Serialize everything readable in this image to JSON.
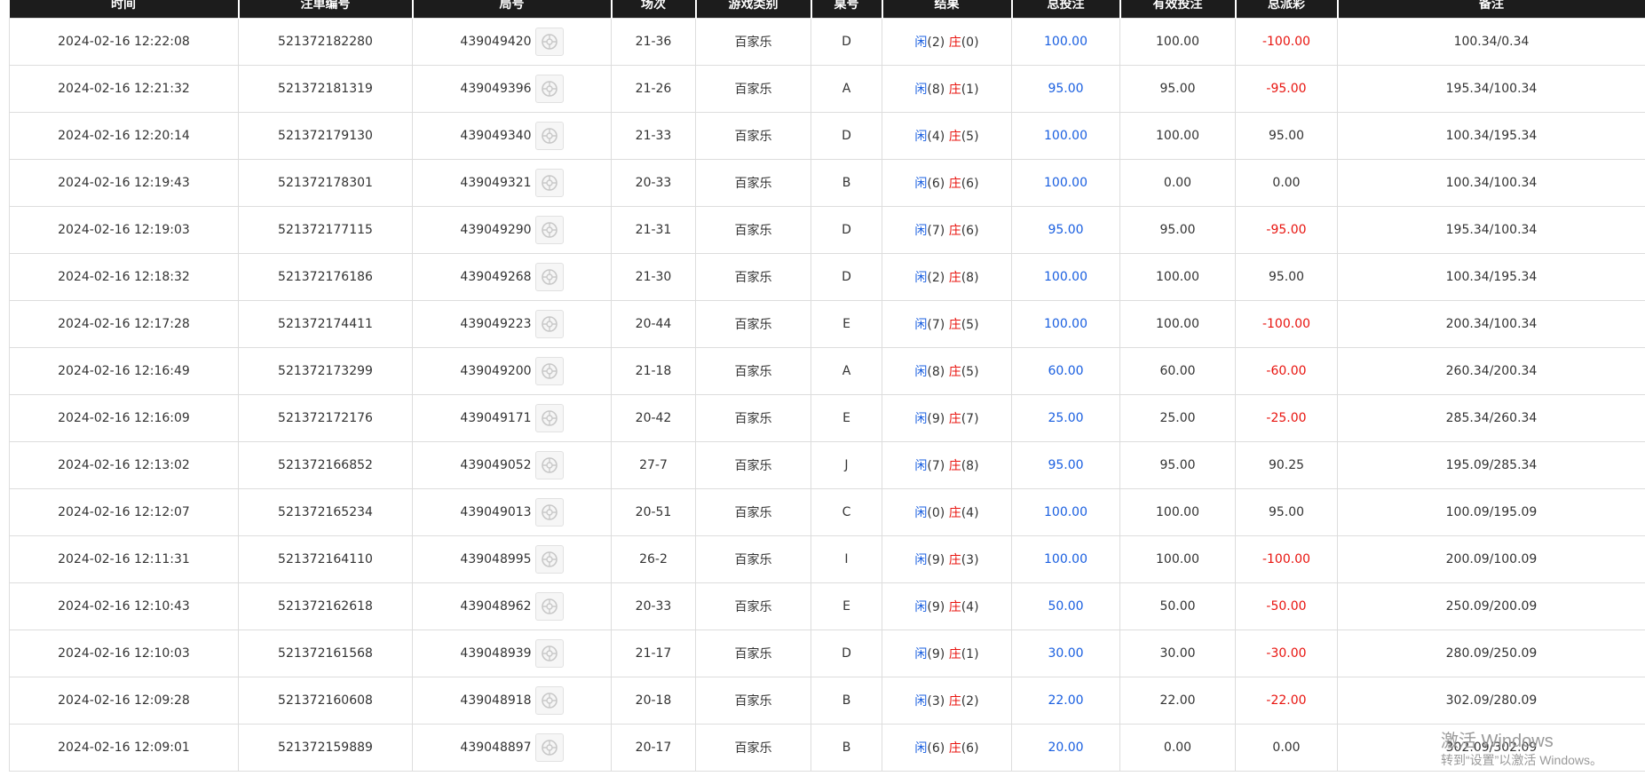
{
  "columns": [
    "时间",
    "注单编号",
    "局号",
    "场次",
    "游戏类别",
    "桌号",
    "结果",
    "总投注",
    "有效投注",
    "总派彩",
    "备注"
  ],
  "result_labels": {
    "player": "闲",
    "banker": "庄"
  },
  "rows": [
    {
      "time": "2024-02-16 12:22:08",
      "order_no": "521372182280",
      "round_no": "439049420",
      "session": "21-36",
      "game": "百家乐",
      "table": "D",
      "player": "(2)",
      "banker": "(0)",
      "total_bet": "100.00",
      "valid_bet": "100.00",
      "payout": "-100.00",
      "note": "100.34/0.34"
    },
    {
      "time": "2024-02-16 12:21:32",
      "order_no": "521372181319",
      "round_no": "439049396",
      "session": "21-26",
      "game": "百家乐",
      "table": "A",
      "player": "(8)",
      "banker": "(1)",
      "total_bet": "95.00",
      "valid_bet": "95.00",
      "payout": "-95.00",
      "note": "195.34/100.34"
    },
    {
      "time": "2024-02-16 12:20:14",
      "order_no": "521372179130",
      "round_no": "439049340",
      "session": "21-33",
      "game": "百家乐",
      "table": "D",
      "player": "(4)",
      "banker": "(5)",
      "total_bet": "100.00",
      "valid_bet": "100.00",
      "payout": "95.00",
      "note": "100.34/195.34"
    },
    {
      "time": "2024-02-16 12:19:43",
      "order_no": "521372178301",
      "round_no": "439049321",
      "session": "20-33",
      "game": "百家乐",
      "table": "B",
      "player": "(6)",
      "banker": "(6)",
      "total_bet": "100.00",
      "valid_bet": "0.00",
      "payout": "0.00",
      "note": "100.34/100.34"
    },
    {
      "time": "2024-02-16 12:19:03",
      "order_no": "521372177115",
      "round_no": "439049290",
      "session": "21-31",
      "game": "百家乐",
      "table": "D",
      "player": "(7)",
      "banker": "(6)",
      "total_bet": "95.00",
      "valid_bet": "95.00",
      "payout": "-95.00",
      "note": "195.34/100.34"
    },
    {
      "time": "2024-02-16 12:18:32",
      "order_no": "521372176186",
      "round_no": "439049268",
      "session": "21-30",
      "game": "百家乐",
      "table": "D",
      "player": "(2)",
      "banker": "(8)",
      "total_bet": "100.00",
      "valid_bet": "100.00",
      "payout": "95.00",
      "note": "100.34/195.34"
    },
    {
      "time": "2024-02-16 12:17:28",
      "order_no": "521372174411",
      "round_no": "439049223",
      "session": "20-44",
      "game": "百家乐",
      "table": "E",
      "player": "(7)",
      "banker": "(5)",
      "total_bet": "100.00",
      "valid_bet": "100.00",
      "payout": "-100.00",
      "note": "200.34/100.34"
    },
    {
      "time": "2024-02-16 12:16:49",
      "order_no": "521372173299",
      "round_no": "439049200",
      "session": "21-18",
      "game": "百家乐",
      "table": "A",
      "player": "(8)",
      "banker": "(5)",
      "total_bet": "60.00",
      "valid_bet": "60.00",
      "payout": "-60.00",
      "note": "260.34/200.34"
    },
    {
      "time": "2024-02-16 12:16:09",
      "order_no": "521372172176",
      "round_no": "439049171",
      "session": "20-42",
      "game": "百家乐",
      "table": "E",
      "player": "(9)",
      "banker": "(7)",
      "total_bet": "25.00",
      "valid_bet": "25.00",
      "payout": "-25.00",
      "note": "285.34/260.34"
    },
    {
      "time": "2024-02-16 12:13:02",
      "order_no": "521372166852",
      "round_no": "439049052",
      "session": "27-7",
      "game": "百家乐",
      "table": "J",
      "player": "(7)",
      "banker": "(8)",
      "total_bet": "95.00",
      "valid_bet": "95.00",
      "payout": "90.25",
      "note": "195.09/285.34"
    },
    {
      "time": "2024-02-16 12:12:07",
      "order_no": "521372165234",
      "round_no": "439049013",
      "session": "20-51",
      "game": "百家乐",
      "table": "C",
      "player": "(0)",
      "banker": "(4)",
      "total_bet": "100.00",
      "valid_bet": "100.00",
      "payout": "95.00",
      "note": "100.09/195.09"
    },
    {
      "time": "2024-02-16 12:11:31",
      "order_no": "521372164110",
      "round_no": "439048995",
      "session": "26-2",
      "game": "百家乐",
      "table": "I",
      "player": "(9)",
      "banker": "(3)",
      "total_bet": "100.00",
      "valid_bet": "100.00",
      "payout": "-100.00",
      "note": "200.09/100.09"
    },
    {
      "time": "2024-02-16 12:10:43",
      "order_no": "521372162618",
      "round_no": "439048962",
      "session": "20-33",
      "game": "百家乐",
      "table": "E",
      "player": "(9)",
      "banker": "(4)",
      "total_bet": "50.00",
      "valid_bet": "50.00",
      "payout": "-50.00",
      "note": "250.09/200.09"
    },
    {
      "time": "2024-02-16 12:10:03",
      "order_no": "521372161568",
      "round_no": "439048939",
      "session": "21-17",
      "game": "百家乐",
      "table": "D",
      "player": "(9)",
      "banker": "(1)",
      "total_bet": "30.00",
      "valid_bet": "30.00",
      "payout": "-30.00",
      "note": "280.09/250.09"
    },
    {
      "time": "2024-02-16 12:09:28",
      "order_no": "521372160608",
      "round_no": "439048918",
      "session": "20-18",
      "game": "百家乐",
      "table": "B",
      "player": "(3)",
      "banker": "(2)",
      "total_bet": "22.00",
      "valid_bet": "22.00",
      "payout": "-22.00",
      "note": "302.09/280.09"
    },
    {
      "time": "2024-02-16 12:09:01",
      "order_no": "521372159889",
      "round_no": "439048897",
      "session": "20-17",
      "game": "百家乐",
      "table": "B",
      "player": "(6)",
      "banker": "(6)",
      "total_bet": "20.00",
      "valid_bet": "0.00",
      "payout": "0.00",
      "note": "302.09/302.09"
    }
  ],
  "colors": {
    "header_bg": "#1c1c1c",
    "blue": "#1a5fe0",
    "red": "#e8140f",
    "grid": "#dddddd"
  },
  "icons": {
    "round_replay": "roulette-wheel-icon"
  },
  "watermark": {
    "line1": "激活 Windows",
    "line2": "转到“设置”以激活 Windows。"
  }
}
